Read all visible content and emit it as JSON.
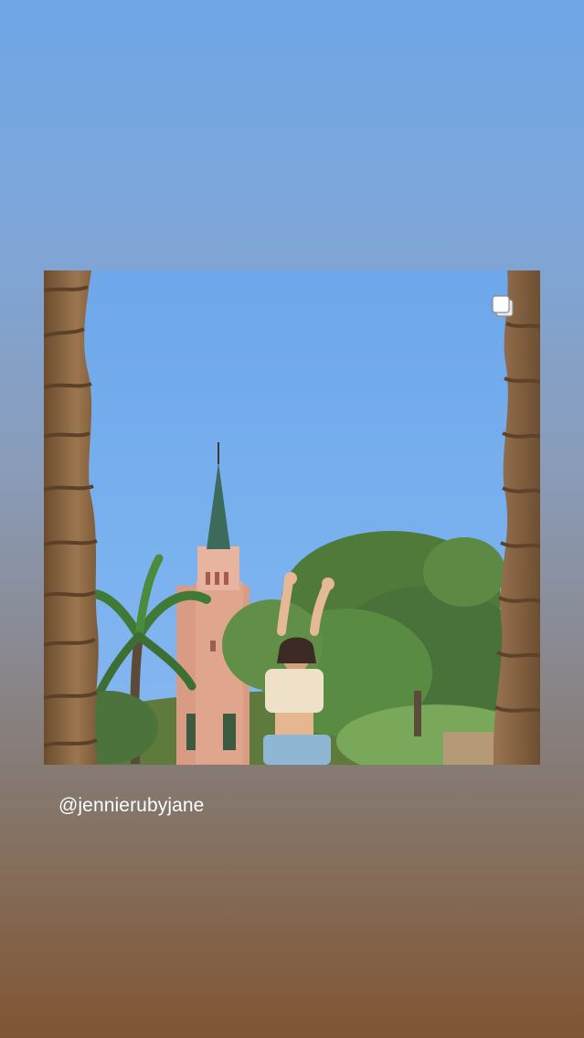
{
  "story": {
    "mention_text": "@jennierubyjane",
    "post_icon": "multiple-posts-icon",
    "background_colors": [
      "#6fa6e6",
      "#815532"
    ]
  }
}
